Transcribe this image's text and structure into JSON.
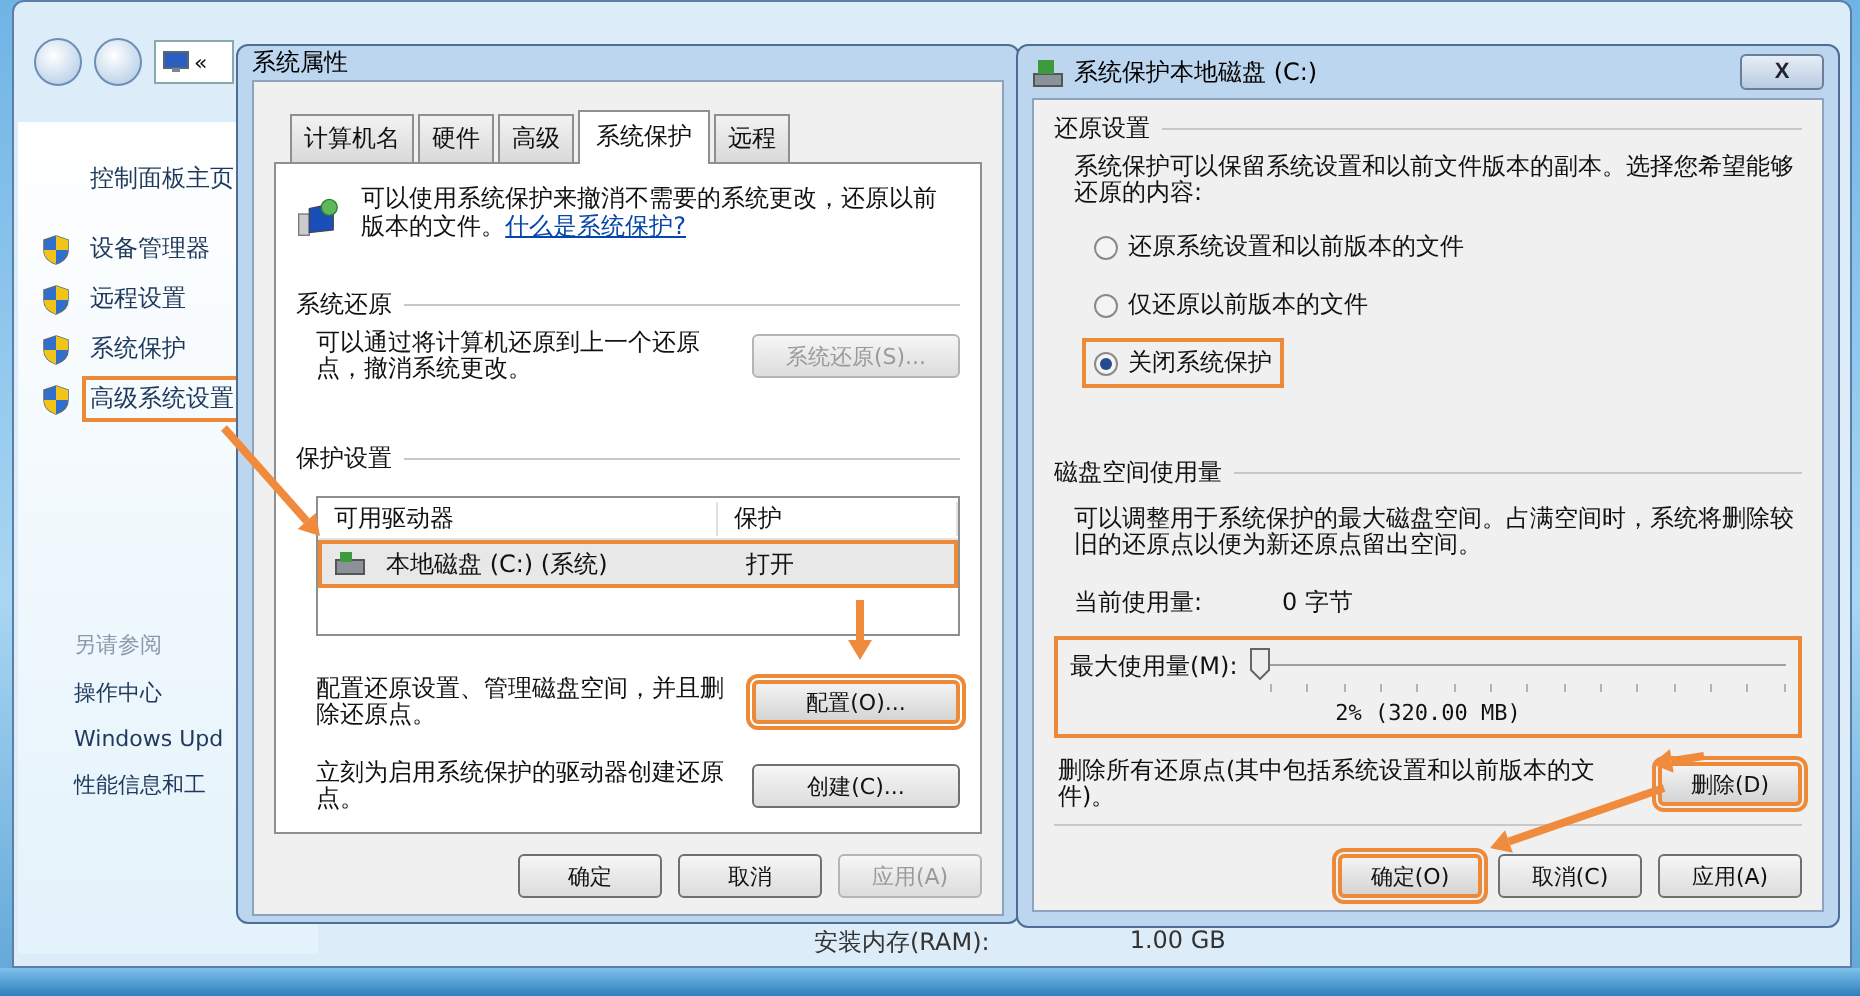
{
  "background_window": {
    "address": "«",
    "sidebar": [
      {
        "label": "控制面板主页",
        "kind": "link",
        "highlighted": false
      },
      {
        "label": "设备管理器",
        "kind": "shield",
        "highlighted": false
      },
      {
        "label": "远程设置",
        "kind": "shield",
        "highlighted": false
      },
      {
        "label": "系统保护",
        "kind": "shield",
        "highlighted": false
      },
      {
        "label": "高级系统设置",
        "kind": "shield",
        "highlighted": true
      }
    ],
    "see_also": {
      "title": "另请参阅",
      "items": [
        "操作中心",
        "Windows Upd",
        "性能信息和工"
      ]
    },
    "details": [
      {
        "label": "安装内存(RAM):",
        "value": "1.00 GB"
      }
    ]
  },
  "system_properties": {
    "title": "系统属性",
    "tabs": [
      {
        "label": "计算机名",
        "selected": false
      },
      {
        "label": "硬件",
        "selected": false
      },
      {
        "label": "高级",
        "selected": false
      },
      {
        "label": "系统保护",
        "selected": true
      },
      {
        "label": "远程",
        "selected": false
      }
    ],
    "intro": {
      "text": "可以使用系统保护来撤消不需要的系统更改，还原以前版本的文件。",
      "link": "什么是系统保护?"
    },
    "restore_group": {
      "title": "系统还原",
      "text": "可以通过将计算机还原到上一个还原点，撤消系统更改。",
      "button": {
        "label": "系统还原(S)...",
        "disabled": true
      }
    },
    "protection_group": {
      "title": "保护设置",
      "columns": [
        "可用驱动器",
        "保护"
      ],
      "rows": [
        {
          "drive": "本地磁盘 (C:) (系统)",
          "protection": "打开",
          "highlighted": true
        }
      ],
      "actions": [
        {
          "text": "配置还原设置、管理磁盘空间，并且删除还原点。",
          "button": {
            "label": "配置(O)...",
            "highlighted": true
          }
        },
        {
          "text": "立刻为启用系统保护的驱动器创建还原点。",
          "button": {
            "label": "创建(C)...",
            "highlighted": false
          }
        }
      ]
    },
    "buttons": [
      {
        "label": "确定",
        "disabled": false
      },
      {
        "label": "取消",
        "disabled": false
      },
      {
        "label": "应用(A)",
        "disabled": true
      }
    ]
  },
  "disk_protection": {
    "title": "系统保护本地磁盘 (C:)",
    "close": "X",
    "restore_group": {
      "title": "还原设置",
      "text": "系统保护可以保留系统设置和以前文件版本的副本。选择您希望能够还原的内容:",
      "options": [
        {
          "label": "还原系统设置和以前版本的文件",
          "selected": false,
          "highlighted": false
        },
        {
          "label": "仅还原以前版本的文件",
          "selected": false,
          "highlighted": false
        },
        {
          "label": "关闭系统保护",
          "selected": true,
          "highlighted": true
        }
      ]
    },
    "usage_group": {
      "title": "磁盘空间使用量",
      "text": "可以调整用于系统保护的最大磁盘空间。占满空间时，系统将删除较旧的还原点以便为新还原点留出空间。",
      "current_label": "当前使用量:",
      "current_value": "0 字节",
      "slider": {
        "label": "最大使用量(M):",
        "level": 0.02,
        "reading": "2% (320.00 MB)",
        "highlighted": true
      }
    },
    "delete": {
      "text": "删除所有还原点(其中包括系统设置和以前版本的文件)。",
      "button": {
        "label": "删除(D)",
        "highlighted": true
      }
    },
    "buttons": [
      {
        "label": "确定(O)",
        "highlighted": true
      },
      {
        "label": "取消(C)",
        "highlighted": false
      },
      {
        "label": "应用(A)",
        "highlighted": false
      }
    ]
  }
}
